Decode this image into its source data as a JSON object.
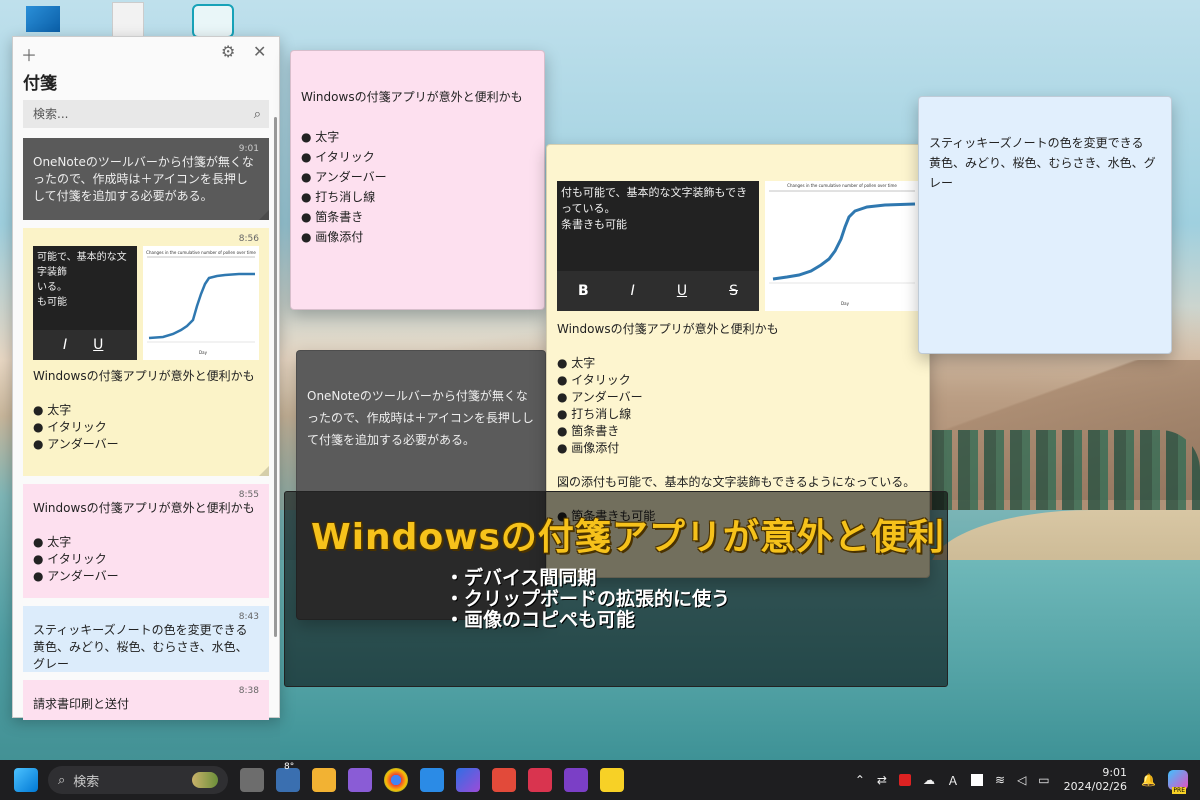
{
  "panel": {
    "title": "付箋",
    "search_placeholder": "検索...",
    "notes": [
      {
        "time": "9:01",
        "text": "OneNoteのツールバーから付箋が無くなったので、作成時は＋アイコンを長押しして付箋を追加する必要がある。"
      },
      {
        "time": "8:56",
        "snip_text": "可能で、基本的な文字装飾\nいる。\nも可能",
        "text": "Windowsの付箋アプリが意外と便利かも\n\n● 太字\n● イタリック\n● アンダーバー"
      },
      {
        "time": "8:55",
        "text": "Windowsの付箋アプリが意外と便利かも\n\n● 太字\n● イタリック\n● アンダーバー"
      },
      {
        "time": "8:43",
        "text": "スティッキーズノートの色を変更できる\n黄色、みどり、桜色、むらさき、水色、グレー"
      },
      {
        "time": "8:38",
        "text": "請求書印刷と送付"
      }
    ]
  },
  "stickies": {
    "pink": "Windowsの付箋アプリが意外と便利かも\n\n● 太字\n● イタリック\n● アンダーバー\n● 打ち消し線\n● 箇条書き\n● 画像添付",
    "dark": "OneNoteのツールバーから付箋が無くなったので、作成時は＋アイコンを長押しして付箋を追加する必要がある。",
    "yellow_snip": "付も可能で、基本的な文字装飾もできっている。\n条書きも可能",
    "yellow": "Windowsの付箋アプリが意外と便利かも\n\n● 太字\n● イタリック\n● アンダーバー\n● 打ち消し線\n● 箇条書き\n● 画像添付\n\n図の添付も可能で、基本的な文字装飾もできるようになっている。\n\n● 箇条書きも可能",
    "blue": "スティッキーズノートの色を変更できる\n黄色、みどり、桜色、むらさき、水色、グレー"
  },
  "chart_caption": "Changes in the cumulative number of pollen over time",
  "chart_axis": "Day",
  "overlay": {
    "headline": "Windowsの付箋アプリが意外と便利",
    "bullets": "・デバイス間同期\n・クリップボードの拡張的に使う\n・画像のコピペも可能"
  },
  "taskbar": {
    "search_placeholder": "検索",
    "weather": "8°",
    "time": "9:01",
    "date": "2024/02/26",
    "copilot_badge": "PRE"
  },
  "colors": {
    "accent_yellow": "#f6c21b",
    "note_yellow": "#fbf3c8",
    "note_pink": "#fde0ef",
    "note_blue": "#dcecfb",
    "note_dark": "#5a5a5a",
    "chart_line": "#2f78b0"
  }
}
